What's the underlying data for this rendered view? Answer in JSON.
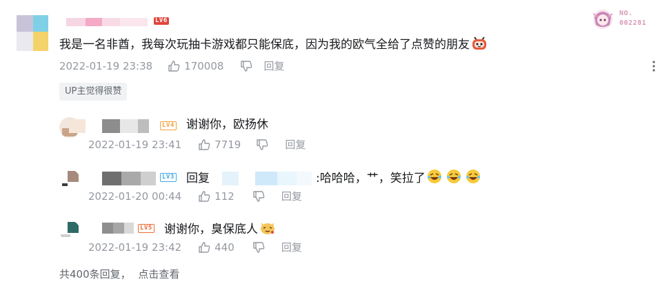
{
  "main_comment": {
    "level": "LV6",
    "text": "我是一名非酋，我每次玩抽卡游戏都只能保底，因为我的欧气全给了点赞的朋友",
    "time": "2022-01-19 23:38",
    "likes": "170008",
    "reply_label": "回复",
    "badge": "UP主觉得很赞",
    "nft_label": "NO.",
    "nft_number": "002281"
  },
  "replies": [
    {
      "level": "LV4",
      "text": "谢谢你，欧扬休",
      "time": "2022-01-19 23:41",
      "likes": "7719",
      "reply_label": "回复"
    },
    {
      "level": "LV3",
      "reply_prefix": "回复",
      "text": ":哈哈哈，艹，笑拉了",
      "time": "2022-01-20 00:44",
      "likes": "112",
      "reply_label": "回复"
    },
    {
      "level": "LV5",
      "text": "谢谢你，臭保底人",
      "time": "2022-01-19 23:42",
      "likes": "440",
      "reply_label": "回复"
    }
  ],
  "footer": {
    "total_replies": "共400条回复，",
    "view_link": "点击查看"
  },
  "icons": {
    "like": "thumbs-up-icon",
    "dislike": "thumbs-down-icon",
    "more": "more-vertical-icon"
  },
  "colors": {
    "meta_text": "#9499a0",
    "lv6": "#e0463e",
    "badge_bg": "#f1f2f3"
  }
}
